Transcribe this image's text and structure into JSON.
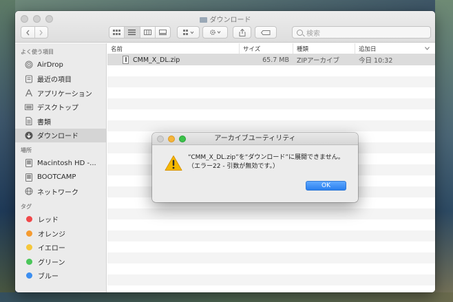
{
  "window": {
    "title": "ダウンロード",
    "search_placeholder": "検索"
  },
  "sidebar": {
    "sections": [
      {
        "header": "よく使う項目",
        "items": [
          {
            "label": "AirDrop",
            "icon": "airdrop-icon"
          },
          {
            "label": "最近の項目",
            "icon": "recent-icon"
          },
          {
            "label": "アプリケーション",
            "icon": "applications-icon"
          },
          {
            "label": "デスクトップ",
            "icon": "desktop-icon"
          },
          {
            "label": "書類",
            "icon": "documents-icon"
          },
          {
            "label": "ダウンロード",
            "icon": "downloads-icon",
            "selected": true
          }
        ]
      },
      {
        "header": "場所",
        "items": [
          {
            "label": "Macintosh HD -...",
            "icon": "disk-icon"
          },
          {
            "label": "BOOTCAMP",
            "icon": "disk-icon"
          },
          {
            "label": "ネットワーク",
            "icon": "network-icon"
          }
        ]
      },
      {
        "header": "タグ",
        "tags": [
          {
            "label": "レッド",
            "color": "#f0484a"
          },
          {
            "label": "オレンジ",
            "color": "#f59b30"
          },
          {
            "label": "イエロー",
            "color": "#f5c73a"
          },
          {
            "label": "グリーン",
            "color": "#4bc65a"
          },
          {
            "label": "ブルー",
            "color": "#3d8ff0"
          }
        ]
      }
    ]
  },
  "filelist": {
    "columns": [
      "名前",
      "サイズ",
      "種類",
      "追加日"
    ],
    "rows": [
      {
        "name": "CMM_X_DL.zip",
        "size": "65.7 MB",
        "kind": "ZIPアーカイブ",
        "date": "今日 10:32"
      }
    ]
  },
  "dialog": {
    "title": "アーカイブユーティリティ",
    "message_line1": "“CMM_X_DL.zip”を“ダウンロード”に展開できません。",
    "message_line2": "（エラー22 - 引数が無効です。）",
    "ok_label": "OK"
  },
  "colors": {
    "accent": "#2a7fee",
    "selection": "#d5d5d5",
    "warning": "#f5b800"
  }
}
